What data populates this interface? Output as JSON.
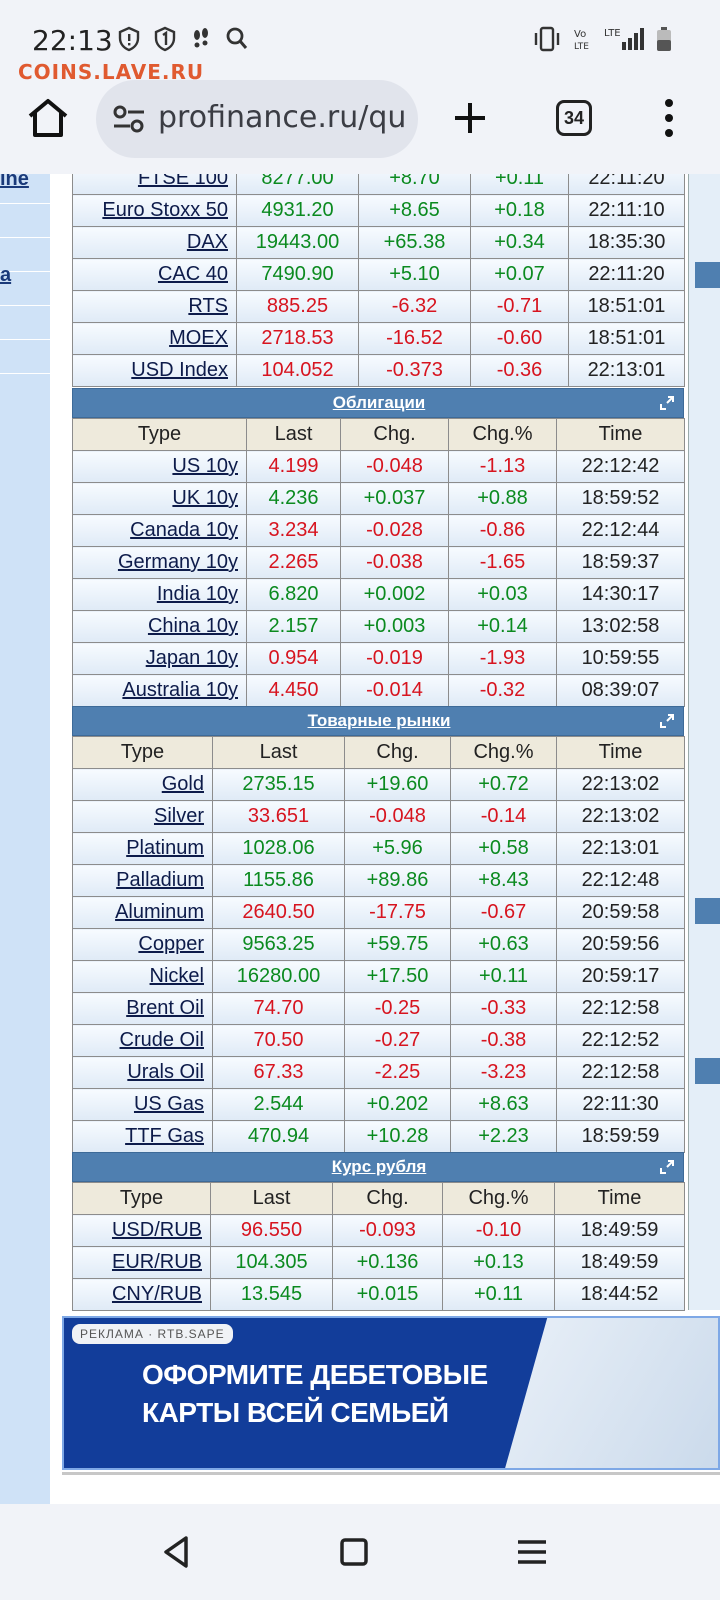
{
  "status_bar": {
    "time": "22:13",
    "watermark": "COINS.LAVE.RU"
  },
  "browser": {
    "url": "profinance.ru/quc",
    "tab_count": "34"
  },
  "left_strip": {
    "links": [
      "ine",
      "a"
    ]
  },
  "indices": {
    "rows": [
      {
        "name": "FTSE 100",
        "last": "8277.00",
        "chg": "+8.70",
        "pct": "+0.11",
        "time": "22:11:20",
        "dir": "up"
      },
      {
        "name": "Euro Stoxx 50",
        "last": "4931.20",
        "chg": "+8.65",
        "pct": "+0.18",
        "time": "22:11:10",
        "dir": "up"
      },
      {
        "name": "DAX",
        "last": "19443.00",
        "chg": "+65.38",
        "pct": "+0.34",
        "time": "18:35:30",
        "dir": "up"
      },
      {
        "name": "CAC 40",
        "last": "7490.90",
        "chg": "+5.10",
        "pct": "+0.07",
        "time": "22:11:20",
        "dir": "up"
      },
      {
        "name": "RTS",
        "last": "885.25",
        "chg": "-6.32",
        "pct": "-0.71",
        "time": "18:51:01",
        "dir": "down"
      },
      {
        "name": "MOEX",
        "last": "2718.53",
        "chg": "-16.52",
        "pct": "-0.60",
        "time": "18:51:01",
        "dir": "down"
      },
      {
        "name": "USD Index",
        "last": "104.052",
        "chg": "-0.373",
        "pct": "-0.36",
        "time": "22:13:01",
        "dir": "down"
      }
    ]
  },
  "columns": {
    "type": "Type",
    "last": "Last",
    "chg": "Chg.",
    "pct": "Chg.%",
    "time": "Time"
  },
  "bonds": {
    "title": "Облигации",
    "rows": [
      {
        "name": "US 10y",
        "last": "4.199",
        "chg": "-0.048",
        "pct": "-1.13",
        "time": "22:12:42",
        "dir": "down"
      },
      {
        "name": "UK 10y",
        "last": "4.236",
        "chg": "+0.037",
        "pct": "+0.88",
        "time": "18:59:52",
        "dir": "up"
      },
      {
        "name": "Canada 10y",
        "last": "3.234",
        "chg": "-0.028",
        "pct": "-0.86",
        "time": "22:12:44",
        "dir": "down"
      },
      {
        "name": "Germany 10y",
        "last": "2.265",
        "chg": "-0.038",
        "pct": "-1.65",
        "time": "18:59:37",
        "dir": "down"
      },
      {
        "name": "India 10y",
        "last": "6.820",
        "chg": "+0.002",
        "pct": "+0.03",
        "time": "14:30:17",
        "dir": "up"
      },
      {
        "name": "China 10y",
        "last": "2.157",
        "chg": "+0.003",
        "pct": "+0.14",
        "time": "13:02:58",
        "dir": "up"
      },
      {
        "name": "Japan 10y",
        "last": "0.954",
        "chg": "-0.019",
        "pct": "-1.93",
        "time": "10:59:55",
        "dir": "down"
      },
      {
        "name": "Australia 10y",
        "last": "4.450",
        "chg": "-0.014",
        "pct": "-0.32",
        "time": "08:39:07",
        "dir": "down"
      }
    ]
  },
  "commodities": {
    "title": "Товарные рынки",
    "rows": [
      {
        "name": "Gold",
        "last": "2735.15",
        "chg": "+19.60",
        "pct": "+0.72",
        "time": "22:13:02",
        "dir": "up"
      },
      {
        "name": "Silver",
        "last": "33.651",
        "chg": "-0.048",
        "pct": "-0.14",
        "time": "22:13:02",
        "dir": "down"
      },
      {
        "name": "Platinum",
        "last": "1028.06",
        "chg": "+5.96",
        "pct": "+0.58",
        "time": "22:13:01",
        "dir": "up"
      },
      {
        "name": "Palladium",
        "last": "1155.86",
        "chg": "+89.86",
        "pct": "+8.43",
        "time": "22:12:48",
        "dir": "up"
      },
      {
        "name": "Aluminum",
        "last": "2640.50",
        "chg": "-17.75",
        "pct": "-0.67",
        "time": "20:59:58",
        "dir": "down"
      },
      {
        "name": "Copper",
        "last": "9563.25",
        "chg": "+59.75",
        "pct": "+0.63",
        "time": "20:59:56",
        "dir": "up"
      },
      {
        "name": "Nickel",
        "last": "16280.00",
        "chg": "+17.50",
        "pct": "+0.11",
        "time": "20:59:17",
        "dir": "up"
      },
      {
        "name": "Brent Oil",
        "last": "74.70",
        "chg": "-0.25",
        "pct": "-0.33",
        "time": "22:12:58",
        "dir": "down"
      },
      {
        "name": "Crude Oil",
        "last": "70.50",
        "chg": "-0.27",
        "pct": "-0.38",
        "time": "22:12:52",
        "dir": "down"
      },
      {
        "name": "Urals Oil",
        "last": "67.33",
        "chg": "-2.25",
        "pct": "-3.23",
        "time": "22:12:58",
        "dir": "down"
      },
      {
        "name": "US Gas",
        "last": "2.544",
        "chg": "+0.202",
        "pct": "+8.63",
        "time": "22:11:30",
        "dir": "up"
      },
      {
        "name": "TTF Gas",
        "last": "470.94",
        "chg": "+10.28",
        "pct": "+2.23",
        "time": "18:59:59",
        "dir": "up"
      }
    ]
  },
  "rouble": {
    "title": "Курс рубля",
    "rows": [
      {
        "name": "USD/RUB",
        "last": "96.550",
        "chg": "-0.093",
        "pct": "-0.10",
        "time": "18:49:59",
        "dir": "down"
      },
      {
        "name": "EUR/RUB",
        "last": "104.305",
        "chg": "+0.136",
        "pct": "+0.13",
        "time": "18:49:59",
        "dir": "up"
      },
      {
        "name": "CNY/RUB",
        "last": "13.545",
        "chg": "+0.015",
        "pct": "+0.11",
        "time": "18:44:52",
        "dir": "up"
      }
    ]
  },
  "ad": {
    "label": "РЕКЛАМА · RTB.SAPE",
    "line1": "ОФОРМИТЕ ДЕБЕТОВЫЕ",
    "line2": "КАРТЫ ВСЕЙ СЕМЬЕЙ"
  },
  "colors": {
    "up": "#0b8a1f",
    "down": "#d7141f",
    "section_header": "#4f7fb0"
  }
}
